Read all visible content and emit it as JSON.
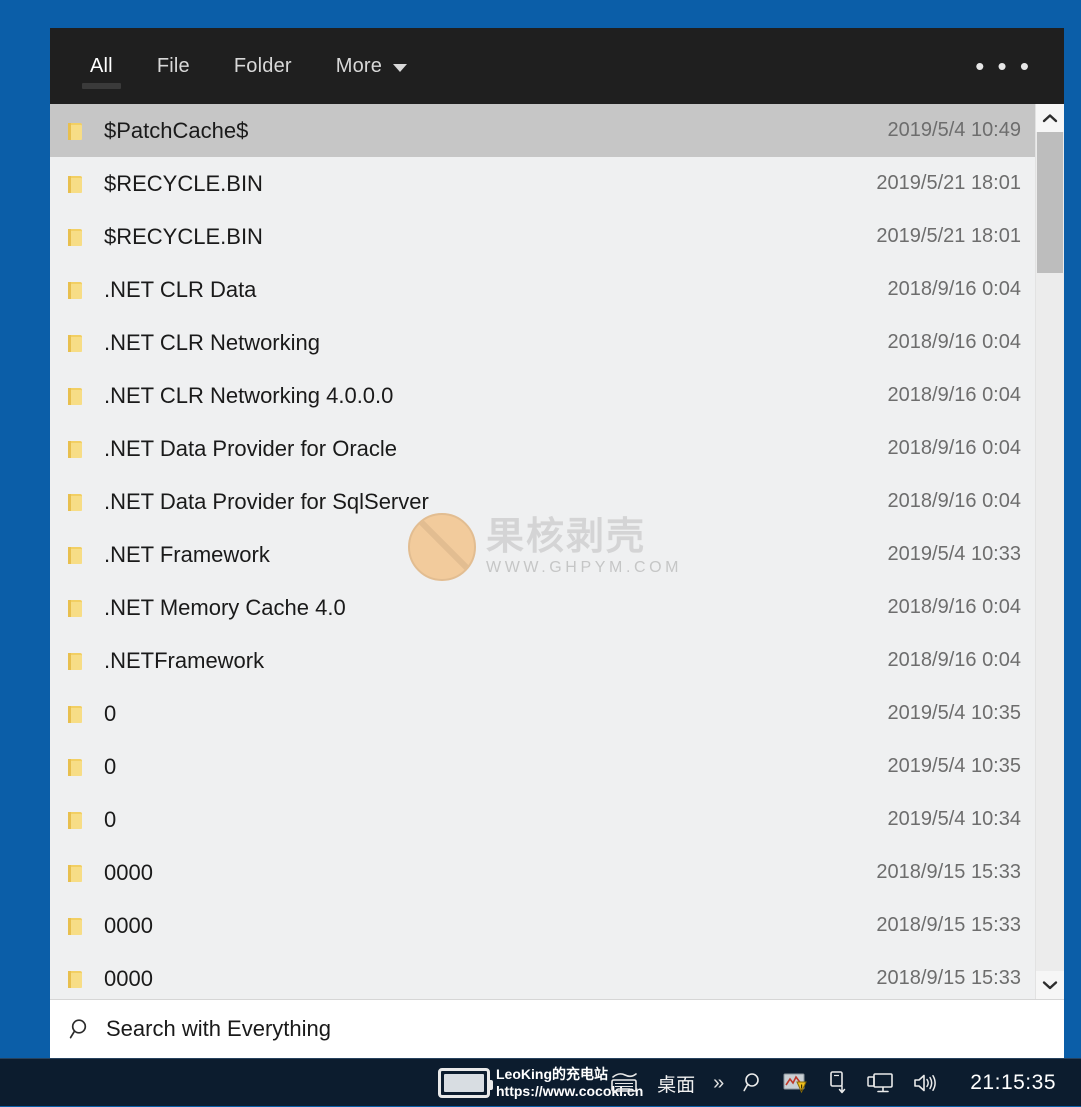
{
  "window": {
    "tabs": [
      {
        "label": "All",
        "active": true
      },
      {
        "label": "File",
        "active": false
      },
      {
        "label": "Folder",
        "active": false
      },
      {
        "label": "More",
        "active": false,
        "has_caret": true
      }
    ],
    "overflow_label": "• • •"
  },
  "results": {
    "rows": [
      {
        "name": "$PatchCache$",
        "date": "2019/5/4 10:49",
        "selected": true
      },
      {
        "name": "$RECYCLE.BIN",
        "date": "2019/5/21 18:01",
        "selected": false
      },
      {
        "name": "$RECYCLE.BIN",
        "date": "2019/5/21 18:01",
        "selected": false
      },
      {
        "name": ".NET CLR Data",
        "date": "2018/9/16 0:04",
        "selected": false
      },
      {
        "name": ".NET CLR Networking",
        "date": "2018/9/16 0:04",
        "selected": false
      },
      {
        "name": ".NET CLR Networking 4.0.0.0",
        "date": "2018/9/16 0:04",
        "selected": false
      },
      {
        "name": ".NET Data Provider for Oracle",
        "date": "2018/9/16 0:04",
        "selected": false
      },
      {
        "name": ".NET Data Provider for SqlServer",
        "date": "2018/9/16 0:04",
        "selected": false
      },
      {
        "name": ".NET Framework",
        "date": "2019/5/4 10:33",
        "selected": false
      },
      {
        "name": ".NET Memory Cache 4.0",
        "date": "2018/9/16 0:04",
        "selected": false
      },
      {
        "name": ".NETFramework",
        "date": "2018/9/16 0:04",
        "selected": false
      },
      {
        "name": "0",
        "date": "2019/5/4 10:35",
        "selected": false
      },
      {
        "name": "0",
        "date": "2019/5/4 10:35",
        "selected": false
      },
      {
        "name": "0",
        "date": "2019/5/4 10:34",
        "selected": false
      },
      {
        "name": "0000",
        "date": "2018/9/15 15:33",
        "selected": false
      },
      {
        "name": "0000",
        "date": "2018/9/15 15:33",
        "selected": false
      },
      {
        "name": "0000",
        "date": "2018/9/15 15:33",
        "selected": false
      }
    ]
  },
  "watermark": {
    "cn_text": "果核剥壳",
    "url_text": "WWW.GHPYM.COM"
  },
  "search": {
    "value": "",
    "placeholder": "Search with Everything"
  },
  "taskbar": {
    "promo_title": "LeoKing的充电站",
    "promo_url": "https://www.cocokl.cn",
    "desktop_label": "桌面",
    "chevrons": "»",
    "clock": "21:15:35"
  },
  "colors": {
    "desktop_blue": "#0b5ea8",
    "header_dark": "#1f1f1f",
    "list_bg": "#eff0f1",
    "selected_row": "#c6c6c6",
    "folder_yellow": "#f2cf63",
    "taskbar": "#0c1c2e"
  }
}
